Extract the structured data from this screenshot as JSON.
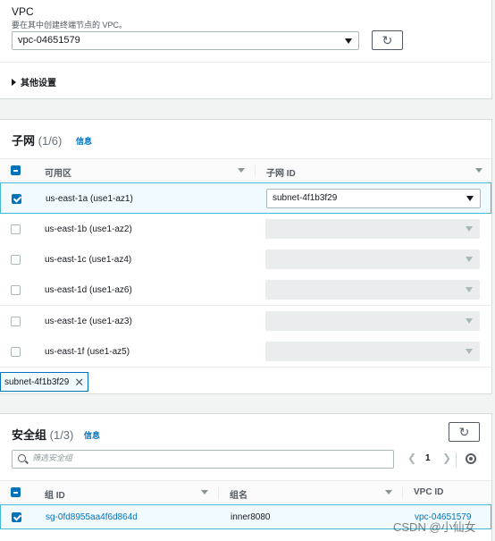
{
  "vpc": {
    "label": "VPC",
    "description": "要在其中创建终端节点的 VPC。",
    "selected": "vpc-04651579",
    "other_settings": "其他设置"
  },
  "subnets": {
    "title": "子网",
    "count": "(1/6)",
    "info": "信息",
    "columns": [
      "可用区",
      "子网 ID"
    ],
    "rows": [
      {
        "az": "us-east-1a (use1-az1)",
        "subnet": "subnet-4f1b3f29",
        "checked": true
      },
      {
        "az": "us-east-1b (use1-az2)",
        "subnet": "",
        "checked": false
      },
      {
        "az": "us-east-1c (use1-az4)",
        "subnet": "",
        "checked": false
      },
      {
        "az": "us-east-1d (use1-az6)",
        "subnet": "",
        "checked": false
      },
      {
        "az": "us-east-1e (use1-az3)",
        "subnet": "",
        "checked": false
      },
      {
        "az": "us-east-1f (use1-az5)",
        "subnet": "",
        "checked": false
      }
    ],
    "token": "subnet-4f1b3f29"
  },
  "security_groups": {
    "title": "安全组",
    "count": "(1/3)",
    "info": "信息",
    "search_placeholder": "筛选安全组",
    "page": "1",
    "columns": [
      "组 ID",
      "组名",
      "VPC ID"
    ],
    "rows": [
      {
        "group_id": "sg-0fd8955aa4f6d864d",
        "group_name": "inner8080",
        "vpc_id": "vpc-04651579",
        "checked": true
      }
    ]
  },
  "watermark": "CSDN @小仙女",
  "colors": {
    "accent": "#0073bb",
    "selected_row_bg": "#f1faff",
    "selected_row_border": "#44b9d6"
  }
}
